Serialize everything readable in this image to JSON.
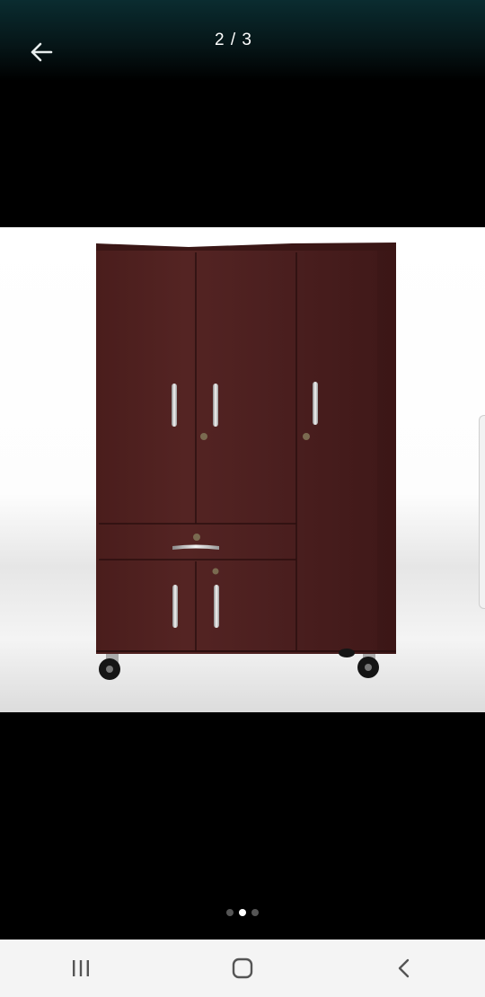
{
  "viewer": {
    "counter": "2 / 3",
    "current_index": 2,
    "total": 3
  },
  "image": {
    "subject": "wardrobe-cabinet"
  },
  "pager": {
    "dots": [
      {
        "active": false
      },
      {
        "active": true
      },
      {
        "active": false
      }
    ]
  },
  "system_nav": {
    "buttons": [
      "recents-icon",
      "home-icon",
      "back-chevron-icon"
    ]
  },
  "colors": {
    "topbar": "#0a2c30",
    "background": "#000000",
    "wood": "#4a1f1e",
    "navbar": "#f4f4f4",
    "nav_icon": "#555555"
  }
}
